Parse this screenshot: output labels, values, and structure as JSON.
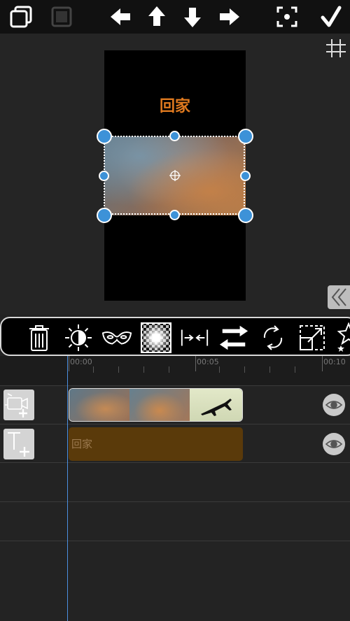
{
  "toolbar": {
    "icons": [
      "copy-icon",
      "stop-icon",
      "arrow-left-icon",
      "arrow-up-icon",
      "arrow-down-icon",
      "arrow-right-icon",
      "focus-icon",
      "checkmark-icon"
    ]
  },
  "preview": {
    "overlay_text": "回家"
  },
  "effects": {
    "icons": [
      "trash-icon",
      "brightness-icon",
      "mask-icon",
      "vignette-icon",
      "split-icon",
      "swap-icon",
      "rotate-icon",
      "resize-icon",
      "sparkle-icon"
    ]
  },
  "timeline": {
    "ticks": [
      "00:00",
      "00:05",
      "00:10"
    ],
    "text_clip_label": "回家"
  },
  "colors": {
    "accent_blue": "#3d92d8",
    "text_orange": "#e07a1f",
    "text_clip_bg": "#5a3a0a"
  }
}
